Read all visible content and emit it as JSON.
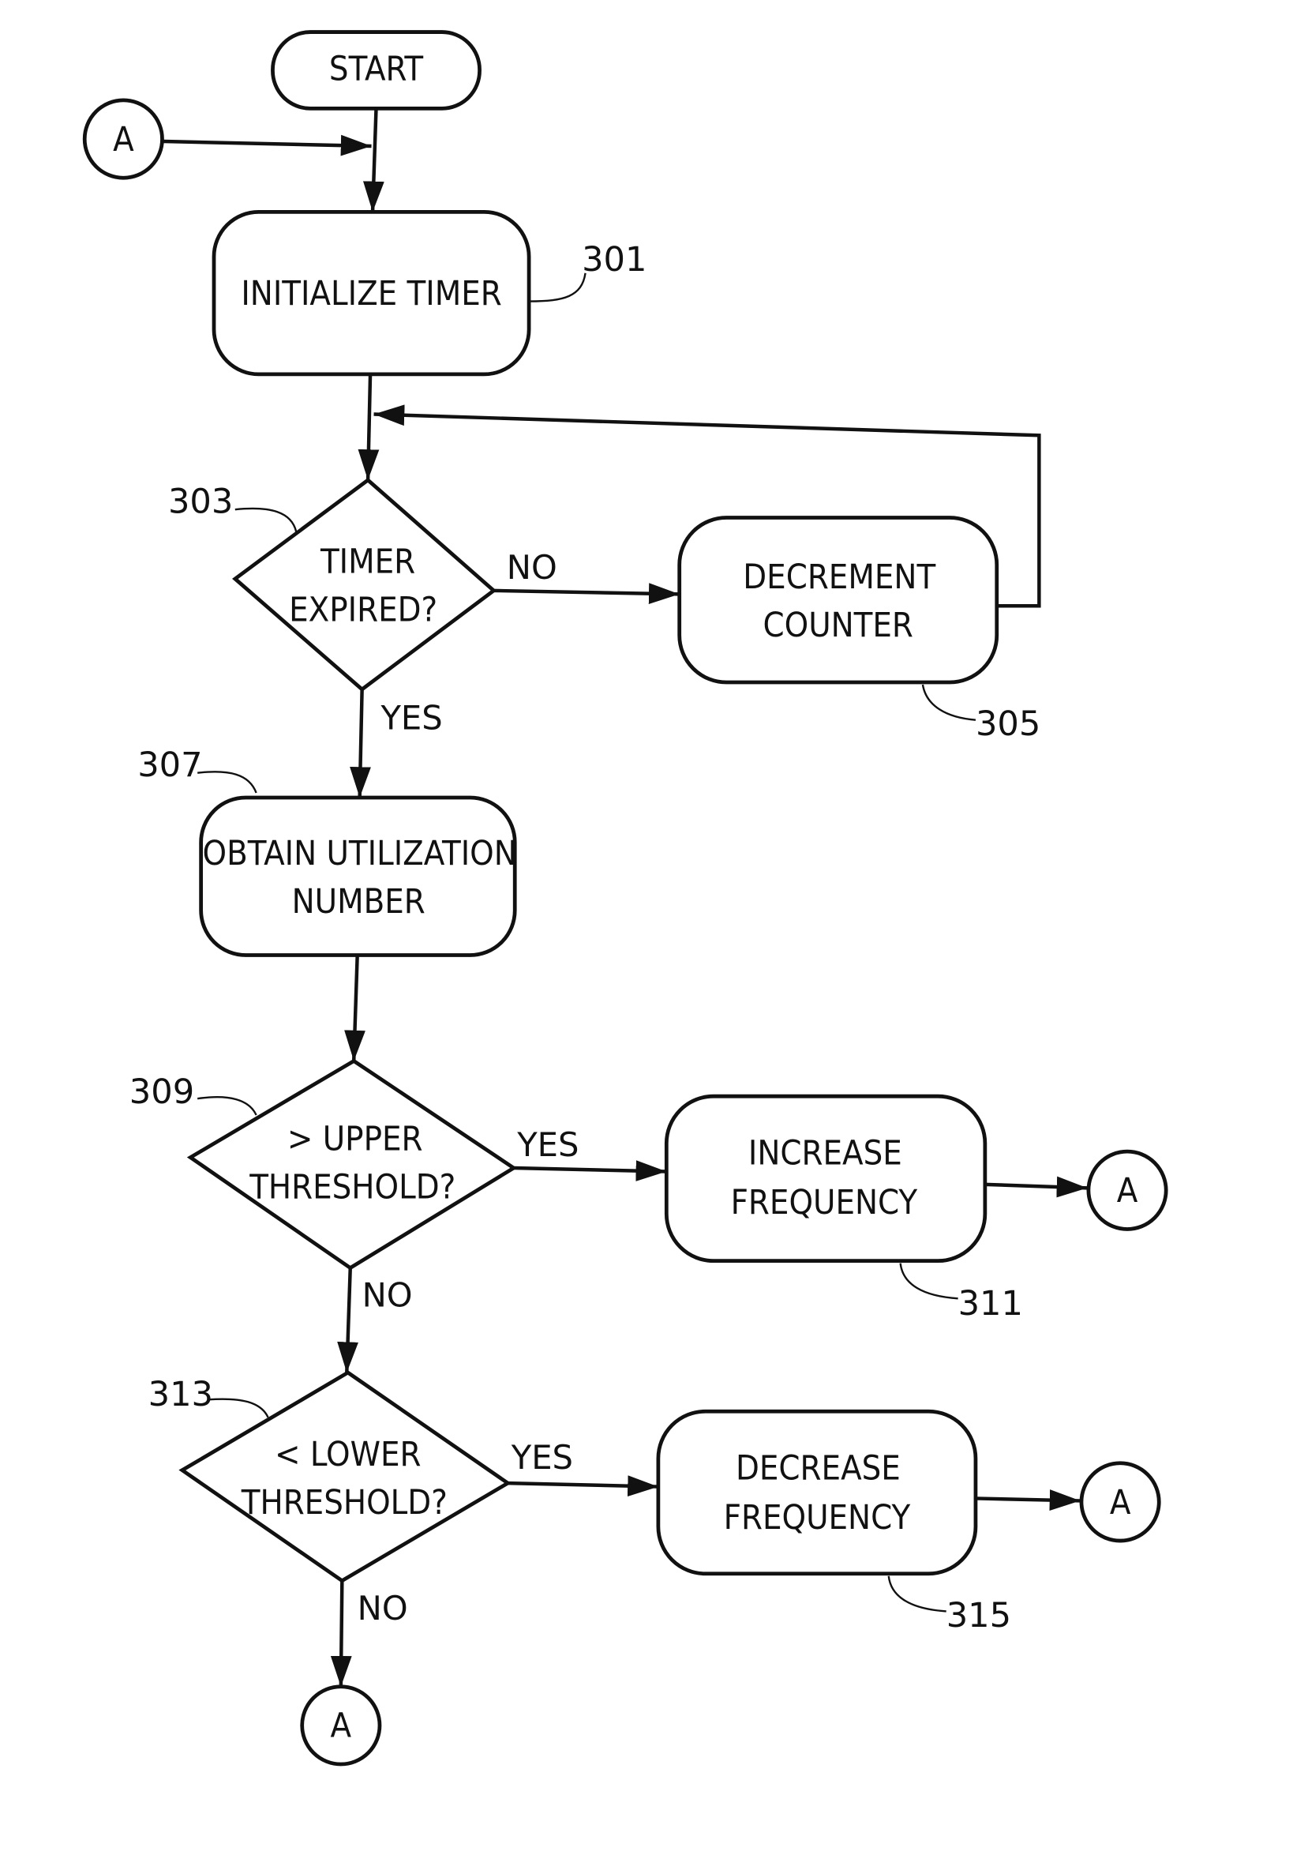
{
  "diagram": {
    "type": "flowchart",
    "nodes": {
      "start": {
        "label": "START"
      },
      "init_timer": {
        "line1": "INITIALIZE TIMER",
        "ref": "301"
      },
      "timer_expired": {
        "line1": "TIMER",
        "line2": "EXPIRED?",
        "ref": "303"
      },
      "decrement_counter": {
        "line1": "DECREMENT",
        "line2": "COUNTER",
        "ref": "305"
      },
      "obtain_utilization": {
        "line1": "OBTAIN UTILIZATION",
        "line2": "NUMBER",
        "ref": "307"
      },
      "upper_threshold": {
        "line1": "> UPPER",
        "line2": "THRESHOLD?",
        "ref": "309"
      },
      "increase_frequency": {
        "line1": "INCREASE",
        "line2": "FREQUENCY",
        "ref": "311"
      },
      "lower_threshold": {
        "line1": "< LOWER",
        "line2": "THRESHOLD?",
        "ref": "313"
      },
      "decrease_frequency": {
        "line1": "DECREASE",
        "line2": "FREQUENCY",
        "ref": "315"
      }
    },
    "connectors": {
      "entry": "A",
      "after_increase": "A",
      "after_decrease": "A",
      "after_lower_no": "A"
    },
    "edge_labels": {
      "timer_no": "NO",
      "timer_yes": "YES",
      "upper_yes": "YES",
      "upper_no": "NO",
      "lower_yes": "YES",
      "lower_no": "NO"
    },
    "edges": [
      [
        "start",
        "init_timer"
      ],
      [
        "connector_entry",
        "init_timer"
      ],
      [
        "init_timer",
        "timer_expired"
      ],
      [
        "timer_expired",
        "decrement_counter",
        "NO"
      ],
      [
        "decrement_counter",
        "timer_expired"
      ],
      [
        "timer_expired",
        "obtain_utilization",
        "YES"
      ],
      [
        "obtain_utilization",
        "upper_threshold"
      ],
      [
        "upper_threshold",
        "increase_frequency",
        "YES"
      ],
      [
        "increase_frequency",
        "connector_A"
      ],
      [
        "upper_threshold",
        "lower_threshold",
        "NO"
      ],
      [
        "lower_threshold",
        "decrease_frequency",
        "YES"
      ],
      [
        "decrease_frequency",
        "connector_A"
      ],
      [
        "lower_threshold",
        "connector_A",
        "NO"
      ]
    ]
  }
}
